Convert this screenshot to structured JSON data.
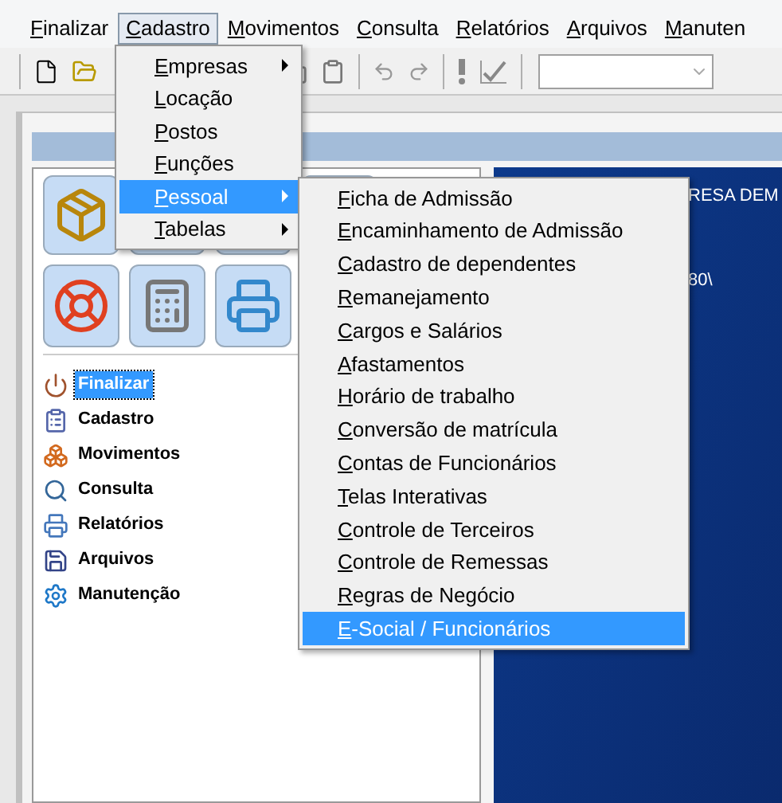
{
  "menubar": [
    {
      "label": "Finalizar",
      "open": false
    },
    {
      "label": "Cadastro",
      "open": true
    },
    {
      "label": "Movimentos",
      "open": false
    },
    {
      "label": "Consulta",
      "open": false
    },
    {
      "label": "Relatórios",
      "open": false
    },
    {
      "label": "Arquivos",
      "open": false
    },
    {
      "label": "Manuten",
      "open": false
    }
  ],
  "cadastro_menu": [
    {
      "label": "Empresas",
      "submenu": true,
      "selected": false
    },
    {
      "label": "Locação",
      "submenu": false,
      "selected": false
    },
    {
      "label": "Postos",
      "submenu": false,
      "selected": false
    },
    {
      "label": "Funções",
      "submenu": false,
      "selected": false
    },
    {
      "label": "Pessoal",
      "submenu": true,
      "selected": true
    },
    {
      "label": "Tabelas",
      "submenu": true,
      "selected": false
    }
  ],
  "pessoal_submenu": [
    {
      "label": "Ficha de Admissão",
      "selected": false
    },
    {
      "label": "Encaminhamento de Admissão",
      "selected": false
    },
    {
      "label": "Cadastro de dependentes",
      "selected": false
    },
    {
      "label": "Remanejamento",
      "selected": false
    },
    {
      "label": "Cargos e Salários",
      "selected": false
    },
    {
      "label": "Afastamentos",
      "selected": false
    },
    {
      "label": "Horário de trabalho",
      "selected": false
    },
    {
      "label": "Conversão de matrícula",
      "selected": false
    },
    {
      "label": "Contas de Funcionários",
      "selected": false
    },
    {
      "label": "Telas Interativas",
      "selected": false
    },
    {
      "label": "Controle de Terceiros",
      "selected": false
    },
    {
      "label": "Controle de Remessas",
      "selected": false
    },
    {
      "label": "Regras de Negócio",
      "selected": false
    },
    {
      "label": "E-Social / Funcionários",
      "selected": true
    }
  ],
  "side_list": [
    {
      "label": "Finalizar",
      "selected": true
    },
    {
      "label": "Cadastro",
      "selected": false
    },
    {
      "label": "Movimentos",
      "selected": false
    },
    {
      "label": "Consulta",
      "selected": false
    },
    {
      "label": "Relatórios",
      "selected": false
    },
    {
      "label": "Arquivos",
      "selected": false
    },
    {
      "label": "Manutenção",
      "selected": false
    }
  ],
  "desktop": {
    "text_1": "RESA DEM",
    "text_2": "80\\"
  }
}
